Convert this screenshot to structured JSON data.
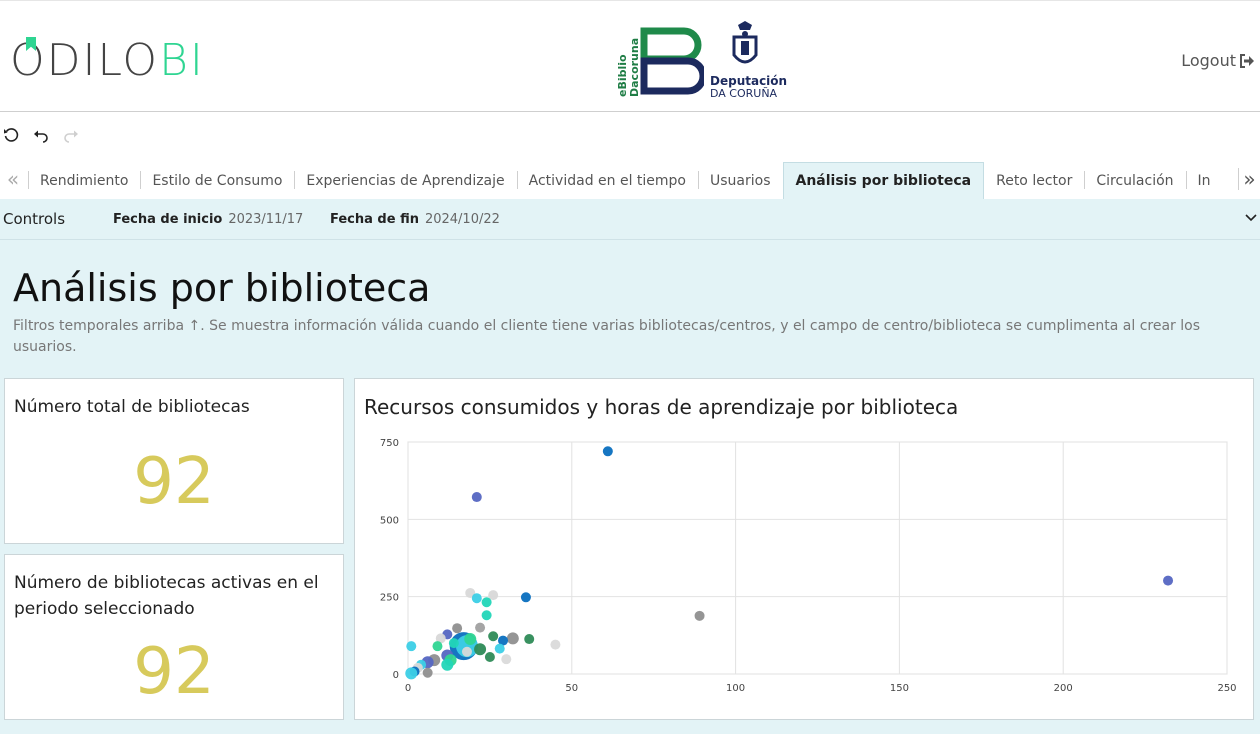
{
  "header": {
    "brand_main": "ODILO",
    "brand_accent": "BI",
    "ebiblio_line1": "eBiblio",
    "ebiblio_line2": "Dacoruna",
    "deputacion_name": "Deputación",
    "deputacion_sub": "DA CORUÑA",
    "logout_label": "Logout"
  },
  "icons": {
    "reset": "reset-icon",
    "undo": "undo-icon",
    "redo": "redo-icon",
    "logout": "sign-out-icon",
    "tabs_prev": "double-chevron-left-icon",
    "tabs_next": "double-chevron-right-icon",
    "controls_toggle": "chevron-down-icon"
  },
  "tabs": [
    {
      "label": "Rendimiento"
    },
    {
      "label": "Estilo de Consumo"
    },
    {
      "label": "Experiencias de Aprendizaje"
    },
    {
      "label": "Actividad en el tiempo"
    },
    {
      "label": "Usuarios"
    },
    {
      "label": "Análisis por biblioteca",
      "active": true
    },
    {
      "label": "Reto lector"
    },
    {
      "label": "Circulación"
    },
    {
      "label": "In"
    }
  ],
  "controls": {
    "label": "Controls",
    "start_label": "Fecha de inicio",
    "start_value": "2023/11/17",
    "end_label": "Fecha de fin",
    "end_value": "2024/10/22"
  },
  "page": {
    "title": "Análisis por biblioteca",
    "description": "Filtros temporales arriba ↑. Se muestra información válida cuando el cliente tiene varias bibliotecas/centros, y el campo de centro/biblioteca se cumplimenta al crear los usuarios."
  },
  "kpis": {
    "total_label": "Número total de bibliotecas",
    "total_value": "92",
    "active_label": "Número de bibliotecas activas en el periodo seleccionado",
    "active_value": "92"
  },
  "colors": {
    "accent_green": "#2fd592",
    "kpi_yellow": "#d7ca5c",
    "panel_bg": "#e3f3f6"
  },
  "chart_data": {
    "type": "scatter",
    "title": "Recursos consumidos y horas de aprendizaje por biblioteca",
    "xlabel": "",
    "ylabel": "",
    "xlim": [
      0,
      250
    ],
    "ylim": [
      0,
      750
    ],
    "xticks": [
      0,
      50,
      100,
      150,
      200,
      250
    ],
    "yticks": [
      0,
      250,
      500,
      750
    ],
    "grid": true,
    "points": [
      {
        "x": 61,
        "y": 720,
        "r": 5,
        "color": "#0a6fbf"
      },
      {
        "x": 21,
        "y": 572,
        "r": 5,
        "color": "#5566c2"
      },
      {
        "x": 232,
        "y": 302,
        "r": 5,
        "color": "#5566c2"
      },
      {
        "x": 89,
        "y": 188,
        "r": 5,
        "color": "#8f8f8f"
      },
      {
        "x": 36,
        "y": 248,
        "r": 5,
        "color": "#0a6fbf"
      },
      {
        "x": 19,
        "y": 262,
        "r": 5,
        "color": "#d8d8d8"
      },
      {
        "x": 26,
        "y": 255,
        "r": 5,
        "color": "#d8d8d8"
      },
      {
        "x": 24,
        "y": 232,
        "r": 5,
        "color": "#22d6b8"
      },
      {
        "x": 21,
        "y": 245,
        "r": 5,
        "color": "#3ccfe6"
      },
      {
        "x": 24,
        "y": 190,
        "r": 5,
        "color": "#22d6b8"
      },
      {
        "x": 45,
        "y": 95,
        "r": 5,
        "color": "#dadada"
      },
      {
        "x": 37,
        "y": 113,
        "r": 5,
        "color": "#2e8b57"
      },
      {
        "x": 32,
        "y": 115,
        "r": 6,
        "color": "#8f8f8f"
      },
      {
        "x": 29,
        "y": 108,
        "r": 5,
        "color": "#0a6fbf"
      },
      {
        "x": 26,
        "y": 122,
        "r": 5,
        "color": "#2e8b57"
      },
      {
        "x": 22,
        "y": 150,
        "r": 5,
        "color": "#a0a0a0"
      },
      {
        "x": 15,
        "y": 148,
        "r": 5,
        "color": "#8f8f8f"
      },
      {
        "x": 12,
        "y": 128,
        "r": 5,
        "color": "#5566c2"
      },
      {
        "x": 10,
        "y": 115,
        "r": 5,
        "color": "#d8d8d8"
      },
      {
        "x": 17,
        "y": 90,
        "r": 14,
        "color": "#0a6fbf"
      },
      {
        "x": 18,
        "y": 90,
        "r": 11,
        "color": "#3ccfe6"
      },
      {
        "x": 19,
        "y": 113,
        "r": 6,
        "color": "#2fd592"
      },
      {
        "x": 22,
        "y": 80,
        "r": 6,
        "color": "#2e8b57"
      },
      {
        "x": 18,
        "y": 72,
        "r": 5,
        "color": "#d8d8d8"
      },
      {
        "x": 28,
        "y": 82,
        "r": 5,
        "color": "#3ccfe6"
      },
      {
        "x": 25,
        "y": 55,
        "r": 5,
        "color": "#2e8b57"
      },
      {
        "x": 30,
        "y": 48,
        "r": 5,
        "color": "#dadada"
      },
      {
        "x": 12,
        "y": 60,
        "r": 6,
        "color": "#5566c2"
      },
      {
        "x": 13,
        "y": 45,
        "r": 6,
        "color": "#2fd592"
      },
      {
        "x": 12,
        "y": 30,
        "r": 6,
        "color": "#22d6b8"
      },
      {
        "x": 8,
        "y": 45,
        "r": 6,
        "color": "#8f8f8f"
      },
      {
        "x": 6,
        "y": 38,
        "r": 6,
        "color": "#5566c2"
      },
      {
        "x": 4,
        "y": 30,
        "r": 5,
        "color": "#3ccfe6"
      },
      {
        "x": 3,
        "y": 20,
        "r": 5,
        "color": "#d8d8d8"
      },
      {
        "x": 2,
        "y": 8,
        "r": 5,
        "color": "#0a6fbf"
      },
      {
        "x": 1,
        "y": 2,
        "r": 6,
        "color": "#3ccfe6"
      },
      {
        "x": 6,
        "y": 4,
        "r": 5,
        "color": "#8f8f8f"
      },
      {
        "x": 1,
        "y": 90,
        "r": 5,
        "color": "#3ccfe6"
      },
      {
        "x": 9,
        "y": 90,
        "r": 5,
        "color": "#2fd592"
      },
      {
        "x": 14,
        "y": 100,
        "r": 5,
        "color": "#22d6b8"
      }
    ]
  }
}
